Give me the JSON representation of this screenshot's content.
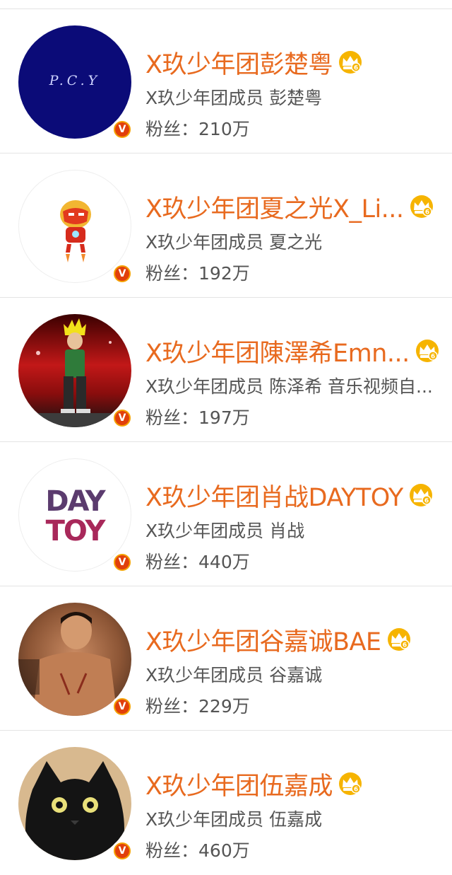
{
  "users": [
    {
      "name": "X玖少年团彭楚粤",
      "description": "X玖少年团成员  彭楚粤",
      "fans_label": "粉丝：",
      "fans_count": "210万",
      "avatar_text": "P.C.Y",
      "verified_glyph": "V"
    },
    {
      "name": "X玖少年团夏之光X_Li...",
      "description": "X玖少年团成员  夏之光",
      "fans_label": "粉丝：",
      "fans_count": "192万",
      "verified_glyph": "V"
    },
    {
      "name": "X玖少年团陳澤希Emn...",
      "description": "X玖少年团成员 陈泽希 音乐视频自...",
      "fans_label": "粉丝：",
      "fans_count": "197万",
      "verified_glyph": "V"
    },
    {
      "name": "X玖少年团肖战DAYTOY",
      "description": "X玖少年团成员 肖战",
      "fans_label": "粉丝：",
      "fans_count": "440万",
      "avatar_text_1": "DAY",
      "avatar_text_2": "TOY",
      "verified_glyph": "V"
    },
    {
      "name": "X玖少年团谷嘉诚BAE",
      "description": "X玖少年团成员  谷嘉诚",
      "fans_label": "粉丝：",
      "fans_count": "229万",
      "verified_glyph": "V"
    },
    {
      "name": "X玖少年团伍嘉成",
      "description": "X玖少年团成员  伍嘉成",
      "fans_label": "粉丝：",
      "fans_count": "460万",
      "verified_glyph": "V"
    }
  ],
  "colors": {
    "name": "#e86a1f",
    "text": "#555555",
    "divider": "#e4e4e4",
    "badge_outer": "#f5a100",
    "badge_inner": "#e13f0b"
  },
  "icons": {
    "verified": "verified-v-icon",
    "member": "crown-member-icon"
  }
}
